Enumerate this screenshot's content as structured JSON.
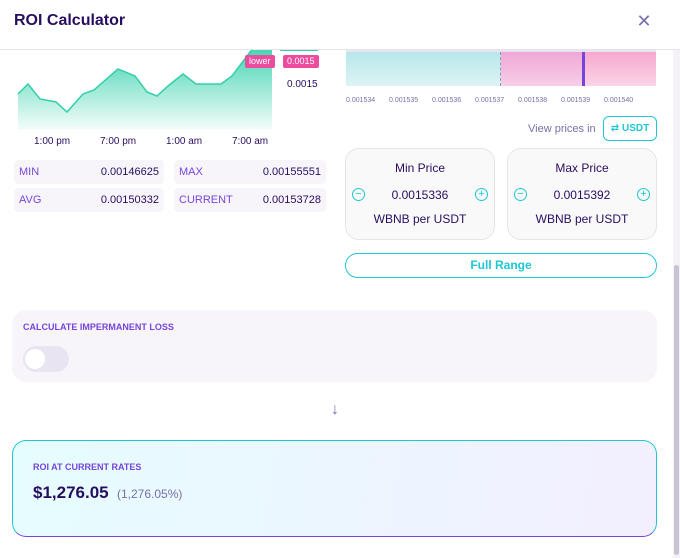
{
  "header": {
    "title": "ROI Calculator",
    "close_icon": "close-icon"
  },
  "chart": {
    "lower_tag": "lower",
    "lower_value": "0.0015",
    "axis_right_value": "0.0015",
    "x_ticks": [
      "1:00 pm",
      "7:00 pm",
      "1:00 am",
      "7:00 am"
    ],
    "accent": "#31d0aa"
  },
  "stats": {
    "min_label": "MIN",
    "min_value": "0.00146625",
    "max_label": "MAX",
    "max_value": "0.00155551",
    "avg_label": "AVG",
    "avg_value": "0.00150332",
    "current_label": "CURRENT",
    "current_value": "0.00153728"
  },
  "range": {
    "ticks": [
      "0.001534",
      "0.001535",
      "0.001536",
      "0.001537",
      "0.001538",
      "0.001539",
      "0.001540"
    ],
    "view_prices_label": "View prices in",
    "currency_toggle": "USDT",
    "min_price": {
      "title": "Min Price",
      "value": "0.0015336",
      "unit": "WBNB per USDT"
    },
    "max_price": {
      "title": "Max Price",
      "value": "0.0015392",
      "unit": "WBNB per USDT"
    },
    "full_range_label": "Full Range"
  },
  "impermanent_loss": {
    "title": "CALCULATE IMPERMANENT LOSS",
    "enabled": false
  },
  "roi": {
    "title": "ROI AT CURRENT RATES",
    "value": "$1,276.05",
    "percent": "(1,276.05%)"
  }
}
